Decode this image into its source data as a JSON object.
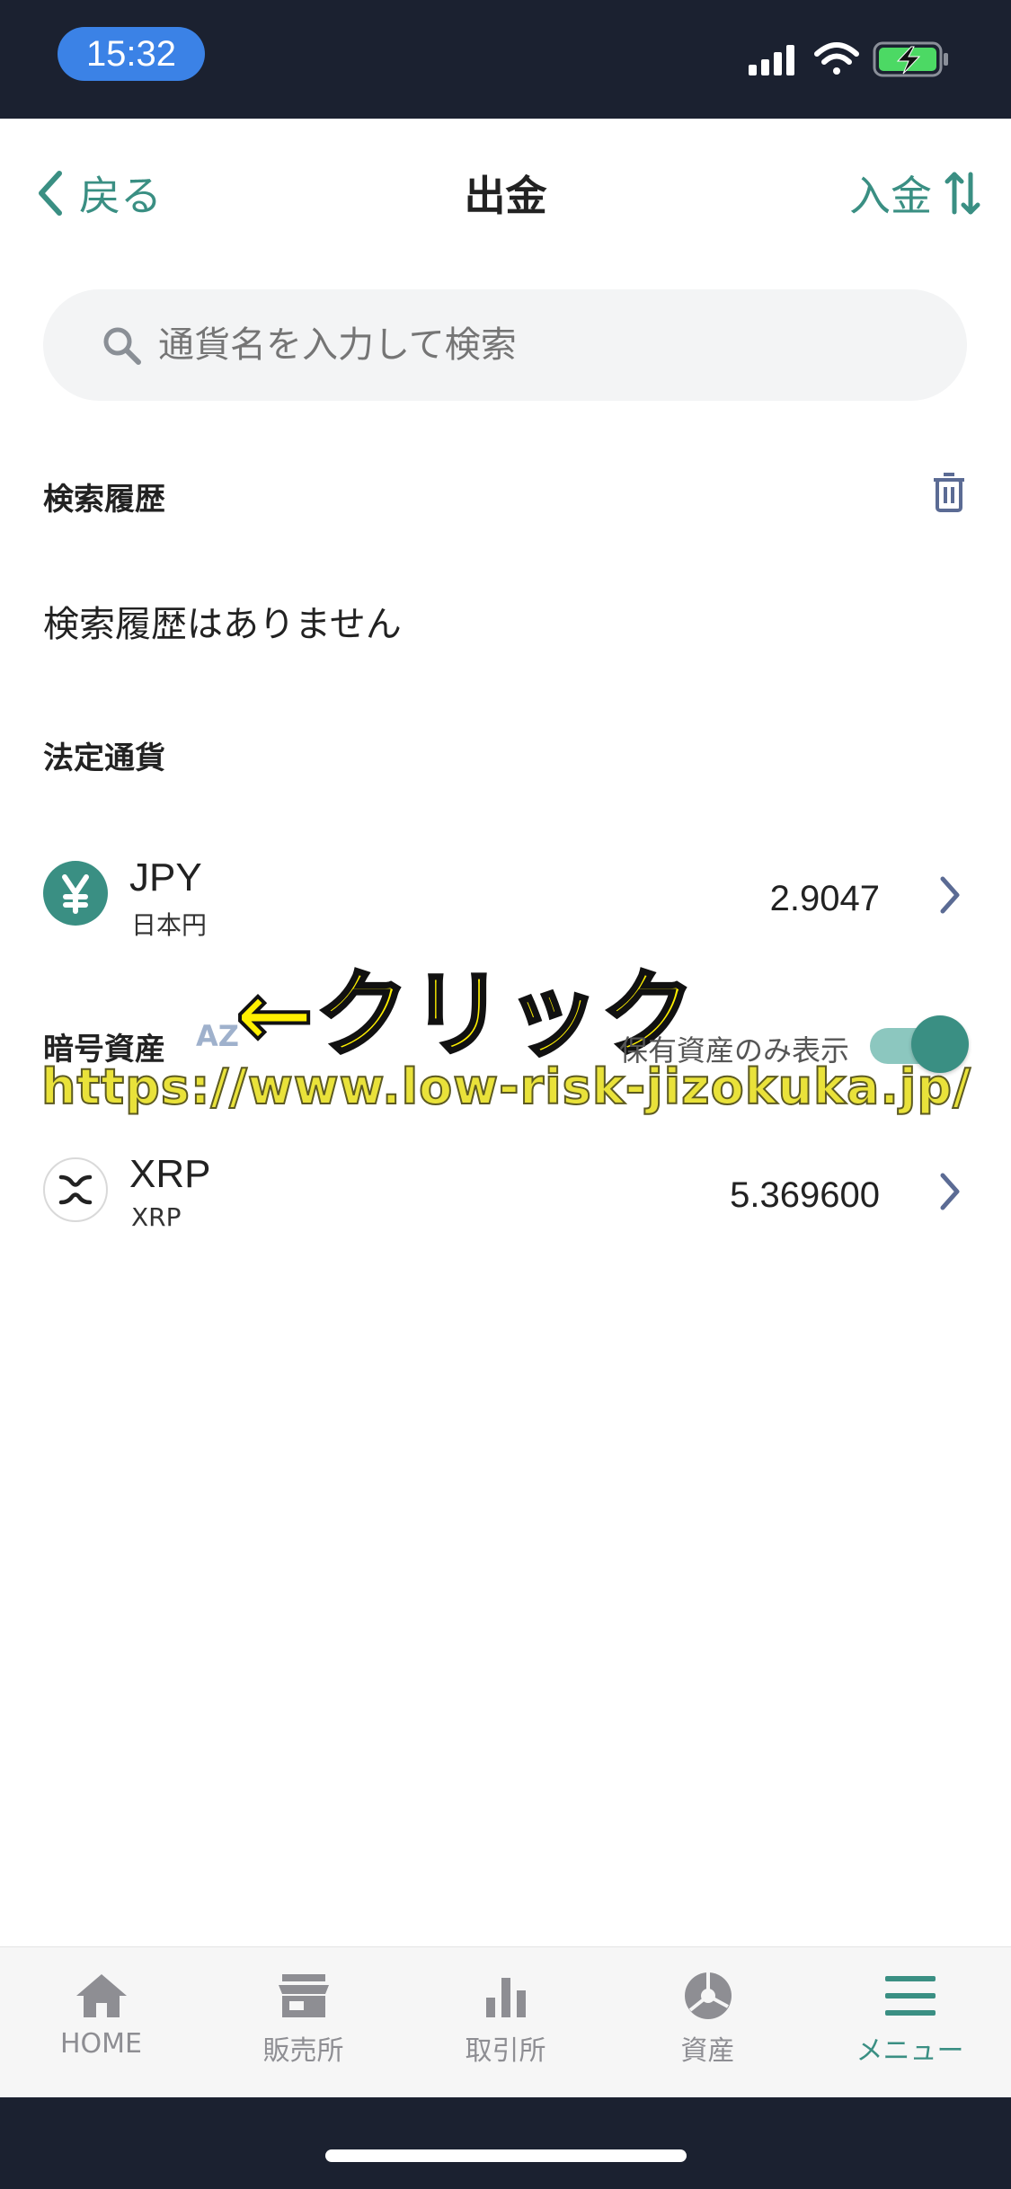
{
  "status_bar": {
    "time": "15:32"
  },
  "nav": {
    "back_label": "戻る",
    "title": "出金",
    "deposit_label": "入金"
  },
  "search": {
    "placeholder": "通貨名を入力して検索"
  },
  "history": {
    "title": "検索履歴",
    "empty_text": "検索履歴はありません"
  },
  "fiat": {
    "title": "法定通貨",
    "items": [
      {
        "symbol": "JPY",
        "name": "日本円",
        "amount": "2.9047"
      }
    ]
  },
  "crypto": {
    "title": "暗号資産",
    "sort_icon": "AZ",
    "holding_only_label": "保有資産のみ表示",
    "holding_only_on": true,
    "items": [
      {
        "symbol": "XRP",
        "name": "XRP",
        "amount": "5.369600"
      }
    ]
  },
  "annotation": {
    "text": "←クリック"
  },
  "watermark": {
    "text": "https://www.low-risk-jizokuka.jp/"
  },
  "tabbar": {
    "tabs": [
      {
        "label": "HOME",
        "icon": "home-icon"
      },
      {
        "label": "販売所",
        "icon": "store-icon"
      },
      {
        "label": "取引所",
        "icon": "bar-chart-icon"
      },
      {
        "label": "資産",
        "icon": "pie-chart-icon"
      },
      {
        "label": "メニュー",
        "icon": "menu-icon",
        "active": true
      }
    ]
  },
  "colors": {
    "accent": "#3a8f83",
    "status_bar": "#1b2130",
    "time_pill": "#3b82e6"
  }
}
